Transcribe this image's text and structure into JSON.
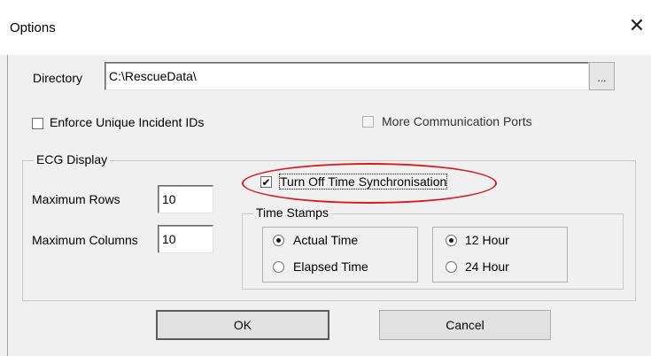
{
  "window": {
    "title": "Options",
    "close_glyph": "✕"
  },
  "directory": {
    "label": "Directory",
    "value": "C:\\RescueData\\",
    "browse_label": "..."
  },
  "checkboxes": {
    "enforce_unique": {
      "label": "Enforce Unique Incident IDs",
      "checked": false
    },
    "more_ports": {
      "label": "More Communication Ports",
      "checked": false,
      "enabled": false
    }
  },
  "ecg": {
    "group_label": "ECG Display",
    "max_rows_label": "Maximum Rows",
    "max_rows_value": "10",
    "max_cols_label": "Maximum Columns",
    "max_cols_value": "10",
    "turn_off_sync": {
      "label": "Turn Off Time Synchronisation",
      "checked": true,
      "check_glyph": "✔"
    },
    "time_stamps": {
      "group_label": "Time Stamps",
      "mode": {
        "actual": "Actual Time",
        "elapsed": "Elapsed Time",
        "selected": "actual"
      },
      "format": {
        "h12": "12 Hour",
        "h24": "24 Hour",
        "selected": "12"
      }
    }
  },
  "buttons": {
    "ok": "OK",
    "cancel": "Cancel"
  },
  "annotation": {
    "highlight_color": "#d42020"
  }
}
